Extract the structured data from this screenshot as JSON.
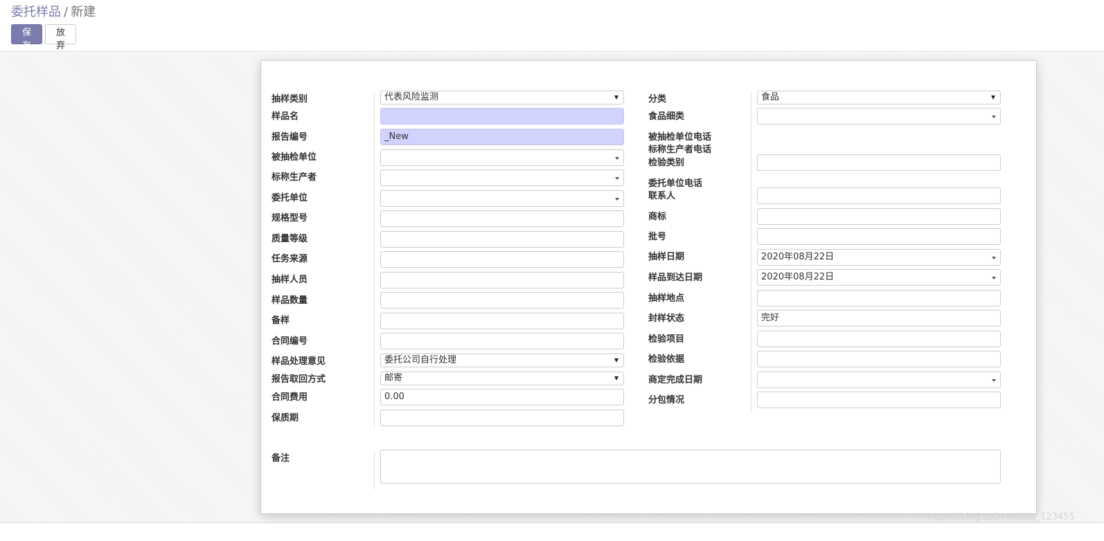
{
  "breadcrumb": {
    "parent": "委托样品",
    "separator": "/",
    "current": "新建"
  },
  "toolbar": {
    "save_label": "保存",
    "discard_label": "放弃"
  },
  "form": {
    "left": {
      "sampling_type": {
        "label": "抽样类别",
        "value": "代表风险监测"
      },
      "sample_name": {
        "label": "样品名",
        "value": ""
      },
      "report_no": {
        "label": "报告编号",
        "value": "_New"
      },
      "inspected_unit": {
        "label": "被抽检单位",
        "value": ""
      },
      "claimed_producer": {
        "label": "标称生产者",
        "value": ""
      },
      "entrusting_unit": {
        "label": "委托单位",
        "value": ""
      },
      "spec_model": {
        "label": "规格型号",
        "value": ""
      },
      "quality_grade": {
        "label": "质量等级",
        "value": ""
      },
      "task_source": {
        "label": "任务来源",
        "value": ""
      },
      "sampler": {
        "label": "抽样人员",
        "value": ""
      },
      "sample_quantity": {
        "label": "样品数量",
        "value": ""
      },
      "reserve_sample": {
        "label": "备样",
        "value": ""
      },
      "contract_no": {
        "label": "合同编号",
        "value": ""
      },
      "disposal_opinion": {
        "label": "样品处理意见",
        "value": "委托公司自行处理"
      },
      "report_retrieval": {
        "label": "报告取回方式",
        "value": "邮寄"
      },
      "contract_fee": {
        "label": "合同费用",
        "value": "0.00"
      },
      "shelf_life": {
        "label": "保质期",
        "value": ""
      }
    },
    "right": {
      "category": {
        "label": "分类",
        "value": "食品"
      },
      "food_subcategory": {
        "label": "食品细类",
        "value": ""
      },
      "inspected_unit_phone": {
        "label": "被抽检单位电话"
      },
      "producer_phone": {
        "label": "标称生产者电话"
      },
      "inspection_type": {
        "label": "检验类别",
        "value": ""
      },
      "entrusting_unit_phone": {
        "label": "委托单位电话"
      },
      "contact": {
        "label": "联系人",
        "value": ""
      },
      "trademark": {
        "label": "商标",
        "value": ""
      },
      "batch_no": {
        "label": "批号",
        "value": ""
      },
      "sampling_date": {
        "label": "抽样日期",
        "value": "2020年08月22日"
      },
      "arrival_date": {
        "label": "样品到达日期",
        "value": "2020年08月22日"
      },
      "sampling_location": {
        "label": "抽样地点",
        "value": ""
      },
      "seal_status": {
        "label": "封样状态",
        "value": "完好"
      },
      "inspection_items": {
        "label": "检验项目",
        "value": ""
      },
      "inspection_basis": {
        "label": "检验依据",
        "value": ""
      },
      "agreed_completion_date": {
        "label": "商定完成日期",
        "value": ""
      },
      "subcontracting": {
        "label": "分包情况",
        "value": ""
      }
    },
    "remarks": {
      "label": "备注",
      "value": ""
    }
  },
  "watermark": "https://blog.csdn.net/qq_123455",
  "colors": {
    "primary": "#7c7bad",
    "required_field": "#d2d2ff"
  }
}
